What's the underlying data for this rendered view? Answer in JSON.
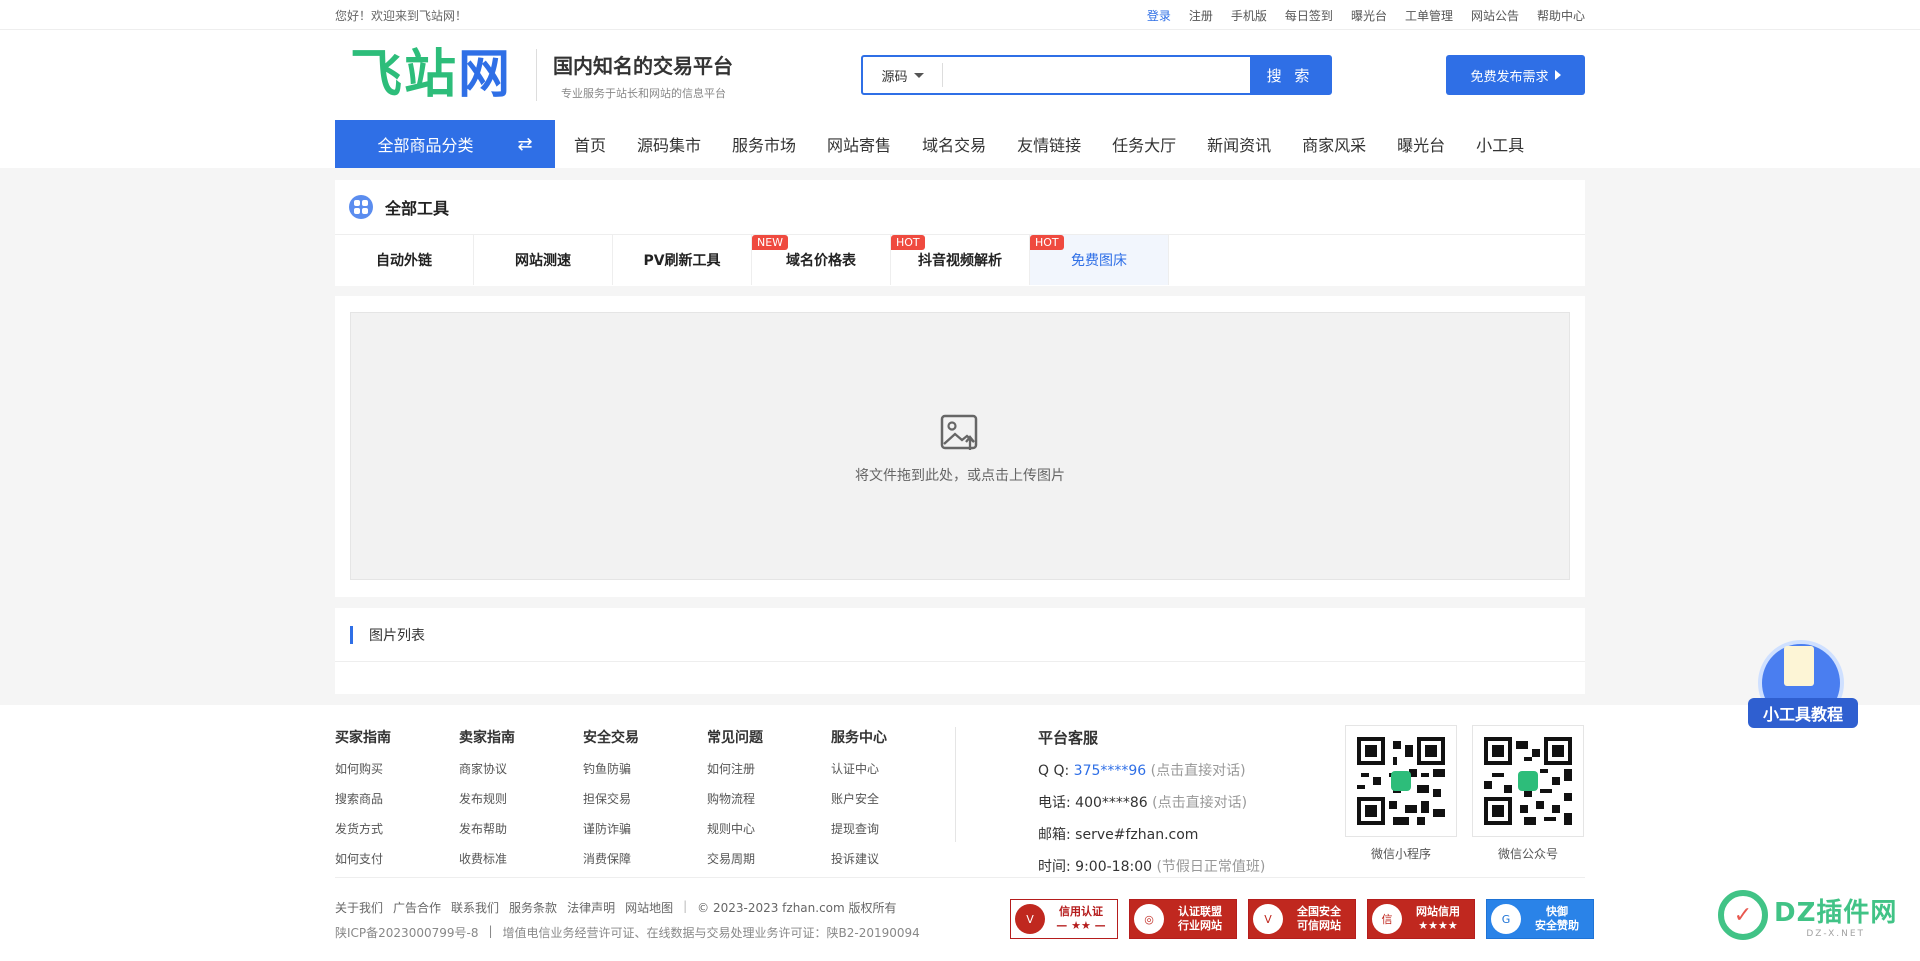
{
  "topbar": {
    "welcome": "您好！欢迎来到飞站网！",
    "links": [
      "登录",
      "注册",
      "手机版",
      "每日签到",
      "曝光台",
      "工单管理",
      "网站公告",
      "帮助中心"
    ]
  },
  "header": {
    "logo_text_a": "飞站",
    "logo_text_b": "网",
    "slogan_title": "国内知名的交易平台",
    "slogan_sub": "专业服务于站长和网站的信息平台",
    "search_select": "源码",
    "search_placeholder": "",
    "search_button": "搜 索",
    "publish_button": "免费发布需求"
  },
  "nav": {
    "all_categories": "全部商品分类",
    "items": [
      "首页",
      "源码集市",
      "服务市场",
      "网站寄售",
      "域名交易",
      "友情链接",
      "任务大厅",
      "新闻资讯",
      "商家风采",
      "曝光台",
      "小工具"
    ]
  },
  "tools": {
    "title": "全部工具",
    "tabs": [
      {
        "label": "自动外链",
        "badge": ""
      },
      {
        "label": "网站测速",
        "badge": ""
      },
      {
        "label": "PV刷新工具",
        "badge": ""
      },
      {
        "label": "域名价格表",
        "badge": "NEW"
      },
      {
        "label": "抖音视频解析",
        "badge": "HOT"
      },
      {
        "label": "免费图床",
        "badge": "HOT"
      }
    ]
  },
  "upload": {
    "hint": "将文件拖到此处，或点击上传图片"
  },
  "image_list": {
    "title": "图片列表"
  },
  "footer": {
    "columns": [
      {
        "title": "买家指南",
        "items": [
          "如何购买",
          "搜索商品",
          "发货方式",
          "如何支付"
        ]
      },
      {
        "title": "卖家指南",
        "items": [
          "商家协议",
          "发布规则",
          "发布帮助",
          "收费标准"
        ]
      },
      {
        "title": "安全交易",
        "items": [
          "钓鱼防骗",
          "担保交易",
          "谨防诈骗",
          "消费保障"
        ]
      },
      {
        "title": "常见问题",
        "items": [
          "如何注册",
          "购物流程",
          "规则中心",
          "交易周期"
        ]
      },
      {
        "title": "服务中心",
        "items": [
          "认证中心",
          "账户安全",
          "提现查询",
          "投诉建议"
        ]
      }
    ],
    "service": {
      "title": "平台客服",
      "qq_label": "Q Q:",
      "qq_value": "375****96",
      "qq_note": "(点击直接对话)",
      "tel_label": "电话:",
      "tel_value": "400****86",
      "tel_note": "(点击直接对话)",
      "mail_label": "邮箱:",
      "mail_value": "serve#fzhan.com",
      "time_label": "时间:",
      "time_value": "9:00-18:00",
      "time_note": "(节假日正常值班)"
    },
    "qr_codes": [
      "微信小程序",
      "微信公众号"
    ],
    "bottom_links": [
      "关于我们",
      "广告合作",
      "联系我们",
      "服务条款",
      "法律声明",
      "网站地图"
    ],
    "copyright": "© 2023-2023 fzhan.com 版权所有",
    "icp": "陕ICP备2023000799号-8",
    "license": "增值电信业务经营许可证、在线数据与交易处理业务许可证：陕B2-20190094",
    "certs": [
      {
        "title": "信用认证",
        "sub": "— ★★ —"
      },
      {
        "title": "认证联盟",
        "sub": "行业网站"
      },
      {
        "title": "全国安全",
        "sub": "可信网站"
      },
      {
        "title": "网站信用",
        "sub": "★★★★"
      },
      {
        "title": "快御",
        "sub": "安全赞助"
      }
    ]
  },
  "floating": {
    "tutorial": "小工具教程"
  },
  "watermark": {
    "text": "DZ插件网",
    "url": "DZ-X.NET"
  },
  "colors": {
    "primary": "#2f6fe6",
    "logo_green": "#2dbd7a",
    "badge_red": "#ef4a3f"
  }
}
